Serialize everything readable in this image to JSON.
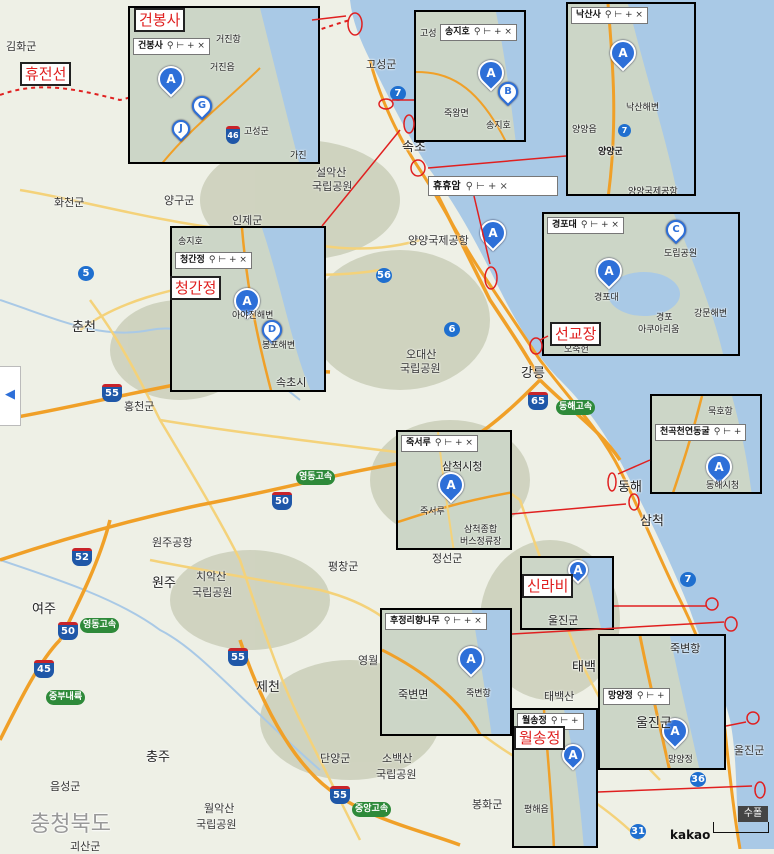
{
  "map": {
    "colors": {
      "land": "#eef0e6",
      "sea": "#a9c9e6",
      "highway": "#f0a028",
      "road": "#f4d27a",
      "mountain": "#c4c9b0",
      "marker": "#2d6fd8",
      "annotation": "#e02020"
    },
    "labels": {
      "gimhwa": "김화군",
      "hwacheon": "화천군",
      "yanggu": "양구군",
      "inje": "인제군",
      "goseong": "고성군",
      "seorak": "설악산",
      "seorak2": "국립공원",
      "sokcho": "속초",
      "yangyang_airport": "양양국제공항",
      "chuncheon": "춘천",
      "hongcheon": "홍천군",
      "odaesan": "오대산",
      "odaesan2": "국립공원",
      "gangneung": "강릉",
      "pyeongchang": "평창군",
      "jeongseon": "정선군",
      "wonju_airport": "원주공항",
      "wonju": "원주",
      "chiak": "치악산",
      "chiak2": "국립공원",
      "yeoju": "여주",
      "jecheon": "제천",
      "yeongwol": "영월",
      "chungju": "충주",
      "danyang": "단양군",
      "sobaek": "소백산",
      "sobaek2": "국립공원",
      "woraksan": "월악산",
      "woraksan2": "국립공원",
      "eumseong": "음성군",
      "goesan": "괴산군",
      "bonghwa": "봉화군",
      "taebaek": "태백",
      "taebaeksan": "태백산",
      "uljin": "울진군",
      "uljin2": "울진군",
      "donghae": "동해",
      "samcheok": "삼척",
      "chungbuk": "충청북도"
    },
    "shields": {
      "r7a": "7",
      "r7b": "7",
      "r56": "56",
      "r5": "5",
      "r6": "6",
      "r55a": "55",
      "r65": "65",
      "r50": "50",
      "r52": "52",
      "r50b": "50",
      "r55b": "55",
      "r45": "45",
      "r55c": "55",
      "r36": "36",
      "r31": "31",
      "r7c": "7",
      "r46": "46",
      "r7d": "7",
      "expy1": "동해고속",
      "expy2": "영동고속",
      "expy3": "중부내륙",
      "expy4": "영동고속",
      "expy5": "중앙고속"
    },
    "highlights": {
      "hyujeonseon": "휴전선",
      "geonbongsa": "건봉사",
      "cheonggan": "청간정",
      "seongyojang": "선교장",
      "sillabi": "신라비",
      "wolsong": "월송정"
    },
    "insets": {
      "geonbong": {
        "bar": "건봉사",
        "labels": [
          "거진읍",
          "거진항",
          "고성군",
          "가진"
        ]
      },
      "songjiho": {
        "bar": "송지호",
        "labels": [
          "고성",
          "죽왕면",
          "송지호"
        ]
      },
      "naksan": {
        "bar": "낙산사",
        "labels": [
          "낙산해변",
          "양양읍",
          "양양군",
          "양양국제공항"
        ]
      },
      "cheonggan": {
        "bar": "청간정",
        "labels": [
          "송지호",
          "아야진해변",
          "봉포해변",
          "속초시"
        ]
      },
      "hyuhyuam": {
        "bar": "휴휴암"
      },
      "gyeongpo": {
        "bar": "경포대",
        "labels": [
          "경포대",
          "도립공원",
          "경포",
          "아쿠아리움",
          "강문해변",
          "오죽헌"
        ]
      },
      "cheongok": {
        "bar": "천곡천연동굴",
        "labels": [
          "묵호항",
          "동해시청"
        ]
      },
      "jukseoru": {
        "bar": "죽서루",
        "labels": [
          "삼척시청",
          "죽서루",
          "삼척종합",
          "버스정류장"
        ]
      },
      "sillabi": {
        "bar": "신라비",
        "labels": [
          "울진군"
        ]
      },
      "hujeongri": {
        "bar": "후정리향나무",
        "labels": [
          "죽변면",
          "죽변항"
        ]
      },
      "mangyang": {
        "bar": "망양정",
        "labels": [
          "죽변항",
          "울진군",
          "망양정"
        ]
      },
      "wolsong": {
        "bar": "월송정",
        "labels": [
          "평해읍"
        ]
      }
    },
    "attribution": "kakao",
    "water_button": "수폴"
  }
}
